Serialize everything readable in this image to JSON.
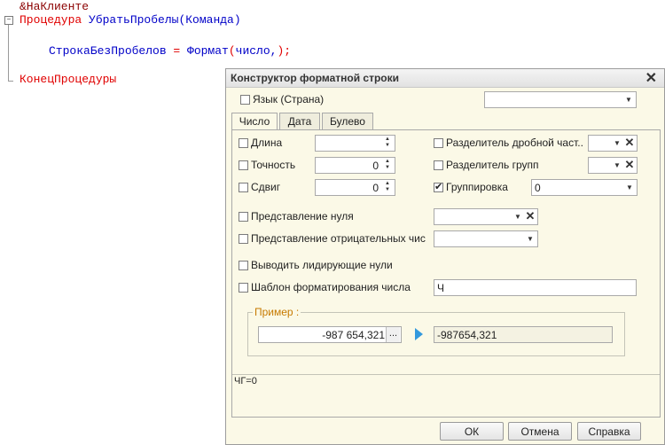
{
  "code": {
    "line1": "&НаКлиенте",
    "line2_kw": "Процедура",
    "line2_name": " УбратьПробелы",
    "line2_args": "(Команда)",
    "line3_var": "СтрокаБезПробелов",
    "line3_eq": " = ",
    "line3_fn": "Формат",
    "line3_open": "(",
    "line3_arg": "число,",
    "line3_close": ")",
    "line3_semi": ";",
    "line4_kw": "КонецПроцедуры",
    "fold_symbol": "−"
  },
  "dialog": {
    "title": "Конструктор форматной строки",
    "close": "✕",
    "language_label": "Язык (Страна)",
    "language_value": "",
    "tabs": [
      "Число",
      "Дата",
      "Булево"
    ],
    "active_tab": 0,
    "fields": {
      "length_label": "Длина",
      "length_value": "",
      "precision_label": "Точность",
      "precision_value": "0",
      "shift_label": "Сдвиг",
      "shift_value": "0",
      "decimal_sep_label": "Разделитель дробной част...",
      "decimal_sep_value": "",
      "group_sep_label": "Разделитель групп",
      "group_sep_value": "",
      "grouping_label": "Группировка",
      "grouping_value": "0",
      "grouping_checked": true,
      "zero_repr_label": "Представление нуля",
      "zero_repr_value": "",
      "negative_repr_label": "Представление отрицательных чис...",
      "negative_repr_value": "",
      "leading_zeros_label": "Выводить лидирующие нули",
      "template_label": "Шаблон форматирования числа",
      "template_value": "Ч"
    },
    "example": {
      "title": "Пример :",
      "input_value": "-987 654,321",
      "dots": "...",
      "output_value": "-987654,321"
    },
    "format_string": "ЧГ=0",
    "buttons": {
      "ok": "ОК",
      "cancel": "Отмена",
      "help": "Справка"
    }
  }
}
